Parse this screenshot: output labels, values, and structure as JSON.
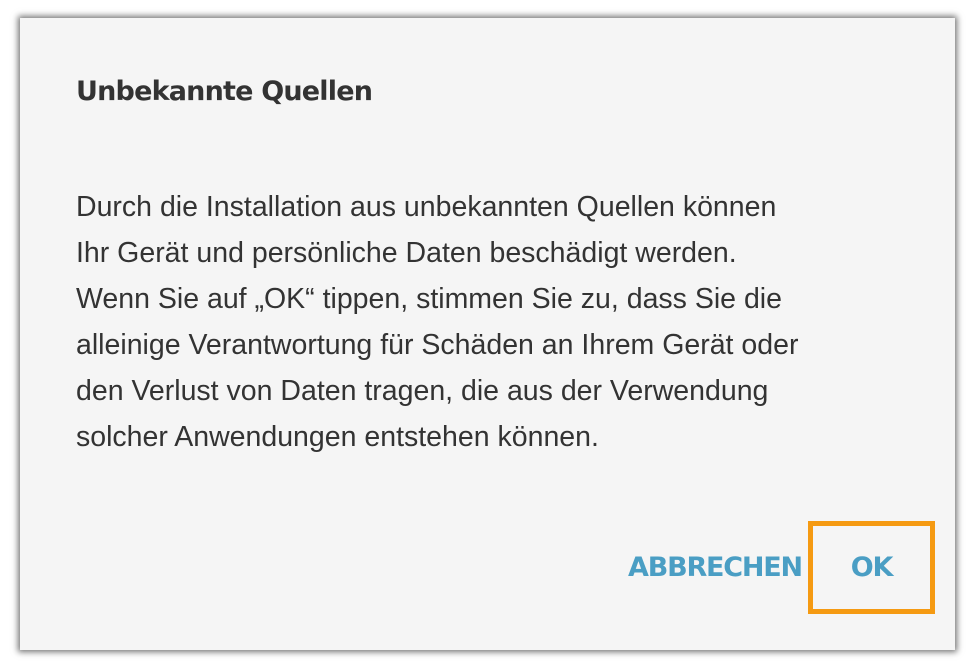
{
  "dialog": {
    "title": "Unbekannte Quellen",
    "message_lines": [
      "Durch die Installation aus unbekannten Quellen können",
      "Ihr Gerät und persönliche Daten beschädigt werden.",
      "Wenn Sie auf „OK“ tippen, stimmen Sie zu, dass Sie die",
      "alleinige Verantwortung für Schäden an Ihrem Gerät oder",
      "den Verlust von Daten tragen, die aus der Verwendung",
      "solcher Anwendungen entstehen können."
    ],
    "cancel_label": "ABBRECHEN",
    "ok_label": "OK"
  },
  "colors": {
    "dialog_background": "#f5f5f5",
    "text": "#333333",
    "button_text": "#4a9ec4",
    "highlight": "#f59a12"
  }
}
